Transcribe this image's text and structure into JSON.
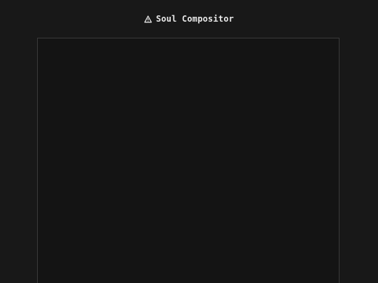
{
  "app": {
    "title": "Soul Compositor",
    "title_icon": "warning-triangle-icon"
  },
  "colors": {
    "background": "#181818",
    "canvas_background": "#141414",
    "canvas_border": "#3a3a3a",
    "title_text": "#e8e8e8"
  }
}
